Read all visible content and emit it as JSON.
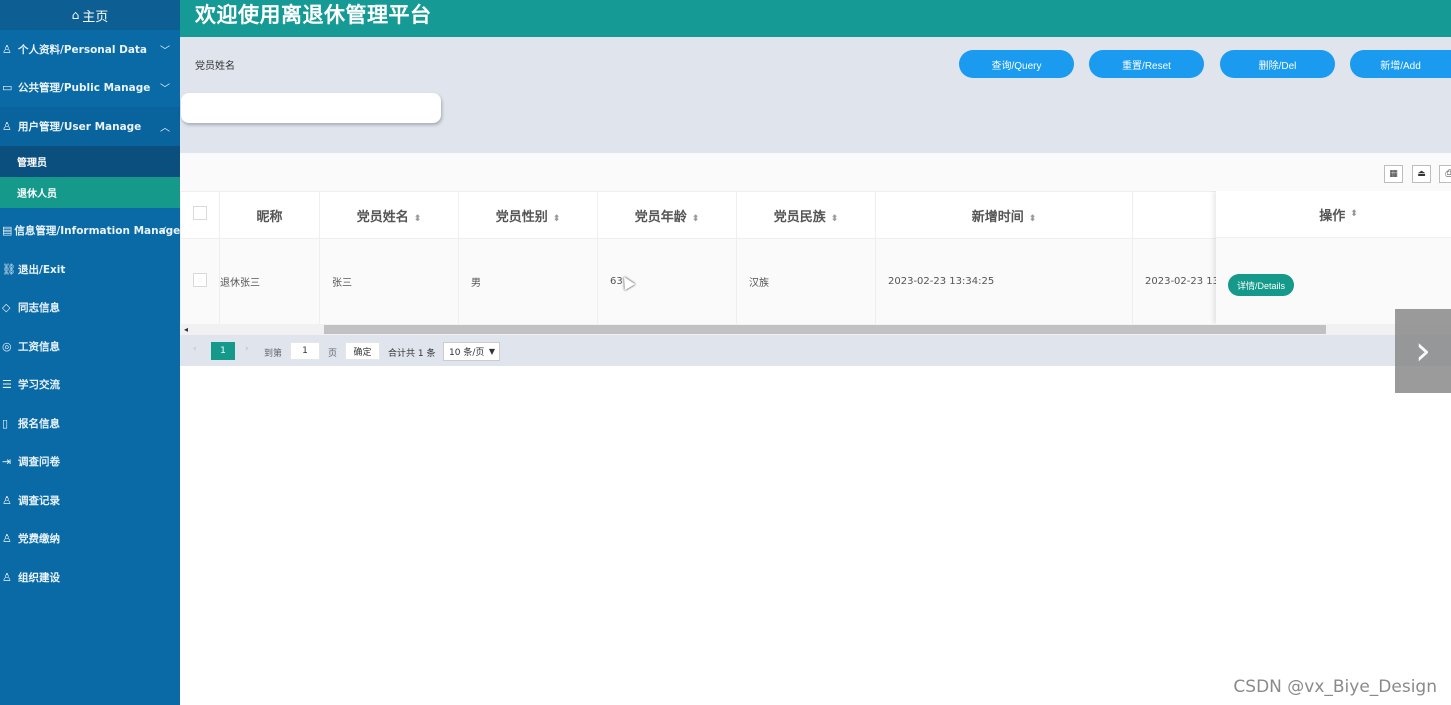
{
  "sidebar": {
    "home_label": "主页",
    "items": [
      {
        "label": "个人资料/Personal Data",
        "chevron": "﹀"
      },
      {
        "label": "公共管理/Public Manage",
        "chevron": "﹀"
      },
      {
        "label": "用户管理/User Manage",
        "chevron": "︿"
      },
      {
        "label": "信息管理/Information Manage",
        "chevron": "✓"
      },
      {
        "label": "退出/Exit"
      },
      {
        "label": "同志信息"
      },
      {
        "label": "工资信息"
      },
      {
        "label": "学习交流"
      },
      {
        "label": "报名信息"
      },
      {
        "label": "调查问卷"
      },
      {
        "label": "调查记录"
      },
      {
        "label": "党费缴纳"
      },
      {
        "label": "组织建设"
      }
    ],
    "submenu": [
      {
        "label": "管理员"
      },
      {
        "label": "退休人员"
      }
    ]
  },
  "header": {
    "title": "欢迎使用离退休管理平台"
  },
  "filter": {
    "label": "党员姓名",
    "placeholder": ""
  },
  "buttons": {
    "query": "查询/Query",
    "reset": "重置/Reset",
    "delete": "删除/Del",
    "add": "新增/Add"
  },
  "table": {
    "headers": [
      "昵称",
      "党员姓名",
      "党员性别",
      "党员年龄",
      "党员民族",
      "新增时间",
      "",
      "操作"
    ],
    "rows": [
      {
        "nickname": "退休张三",
        "name": "张三",
        "gender": "男",
        "age": "63",
        "ethnicity": "汉族",
        "created": "2023-02-23 13:34:25",
        "extra": "2023-02-23 13:",
        "action": "详情/Details"
      }
    ]
  },
  "pager": {
    "current": "1",
    "goto": "到第",
    "page_value": "1",
    "page_unit": "页",
    "confirm": "确定",
    "total": "合计共 1 条",
    "page_size": "10 条/页"
  },
  "watermark": "CSDN @vx_Biye_Design",
  "colors": {
    "sidebar": "#0a6aa6",
    "header": "#159a96",
    "primary_button": "#1a9bf0",
    "active": "#14998a"
  }
}
